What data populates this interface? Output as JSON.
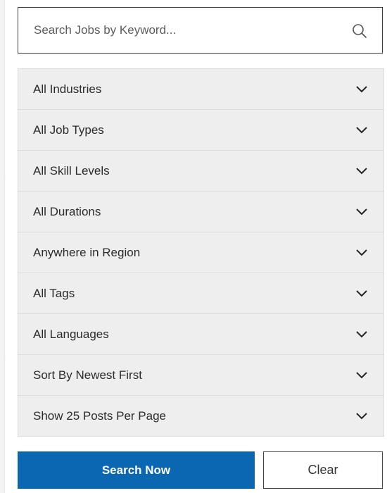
{
  "search": {
    "placeholder": "Search Jobs by Keyword...",
    "value": "",
    "icon": "search-icon"
  },
  "filters": [
    {
      "label": "All Industries",
      "icon": "chevron-down-icon"
    },
    {
      "label": "All Job Types",
      "icon": "chevron-down-icon"
    },
    {
      "label": "All Skill Levels",
      "icon": "chevron-down-icon"
    },
    {
      "label": "All Durations",
      "icon": "chevron-down-icon"
    },
    {
      "label": "Anywhere in Region",
      "icon": "chevron-down-icon"
    },
    {
      "label": "All Tags",
      "icon": "chevron-down-icon"
    },
    {
      "label": "All Languages",
      "icon": "chevron-down-icon"
    },
    {
      "label": "Sort By Newest First",
      "icon": "chevron-down-icon"
    },
    {
      "label": "Show 25 Posts Per Page",
      "icon": "chevron-down-icon"
    }
  ],
  "actions": {
    "search_label": "Search Now",
    "clear_label": "Clear"
  },
  "colors": {
    "primary_button": "#0b67b2",
    "filter_background": "#eeeeee",
    "filter_border": "#dcdcdc"
  }
}
